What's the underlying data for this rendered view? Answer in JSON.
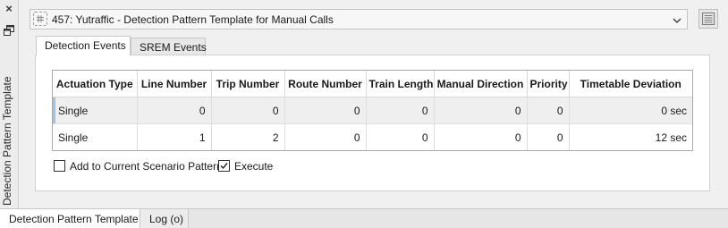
{
  "side_panel": {
    "title": "Detection Pattern Template",
    "close_glyph": "×",
    "float_icon": "float-window-icon"
  },
  "template_selector": {
    "value": "457: Yutraffic - Detection Pattern Template for Manual Calls",
    "icon": "template-icon"
  },
  "list_button_icon": "list-view-icon",
  "tabs": [
    {
      "label": "Detection Events",
      "active": true
    },
    {
      "label": "SREM Events",
      "active": false
    }
  ],
  "table": {
    "columns": [
      "Actuation Type",
      "Line Number",
      "Trip Number",
      "Route Number",
      "Train Length",
      "Manual Direction",
      "Priority",
      "Timetable Deviation"
    ],
    "rows": [
      [
        "Single",
        "0",
        "0",
        "0",
        "0",
        "0",
        "0",
        "0 sec"
      ],
      [
        "Single",
        "1",
        "2",
        "0",
        "0",
        "0",
        "0",
        "12 sec"
      ]
    ]
  },
  "options": {
    "add_to_scenario": {
      "label": "Add to Current Scenario Pattern",
      "checked": false
    },
    "execute": {
      "label": "Execute",
      "checked": true
    }
  },
  "bottom_tabs": [
    {
      "label": "Detection Pattern Template",
      "active": true
    },
    {
      "label": "Log (o)",
      "active": false
    }
  ],
  "colors": {
    "selection_marker": "#9cc3e5",
    "selected_row": "#efefef"
  }
}
